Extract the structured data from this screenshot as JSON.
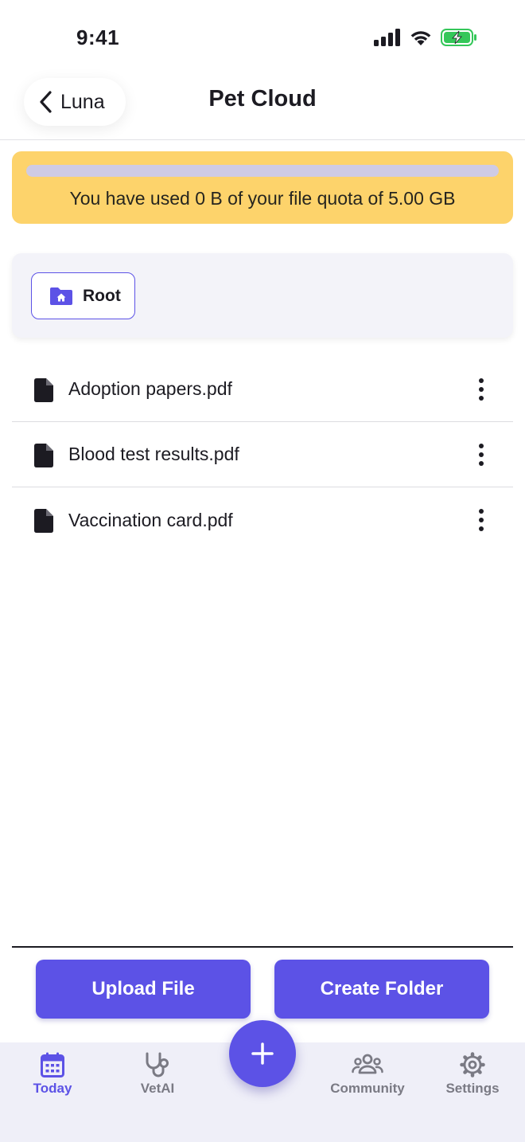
{
  "status_bar": {
    "time": "9:41"
  },
  "header": {
    "back_label": "Luna",
    "title": "Pet Cloud"
  },
  "quota": {
    "text": "You have used 0 B of your file quota of 5.00 GB",
    "used_fraction": 0
  },
  "breadcrumb": {
    "root_label": "Root"
  },
  "files": [
    {
      "name": "Adoption papers.pdf"
    },
    {
      "name": "Blood test results.pdf"
    },
    {
      "name": "Vaccination card.pdf"
    }
  ],
  "actions": {
    "upload_label": "Upload File",
    "create_folder_label": "Create Folder"
  },
  "tabs": [
    {
      "label": "Today",
      "icon": "calendar-icon",
      "active": true
    },
    {
      "label": "VetAI",
      "icon": "stethoscope-icon",
      "active": false
    },
    {
      "label": "Community",
      "icon": "people-icon",
      "active": false
    },
    {
      "label": "Settings",
      "icon": "gear-icon",
      "active": false
    }
  ],
  "colors": {
    "accent": "#5c52e6",
    "banner": "#fdd36b",
    "quota_track": "#cfcbe4",
    "tab_bar": "#efeff8",
    "battery": "#34c759"
  }
}
